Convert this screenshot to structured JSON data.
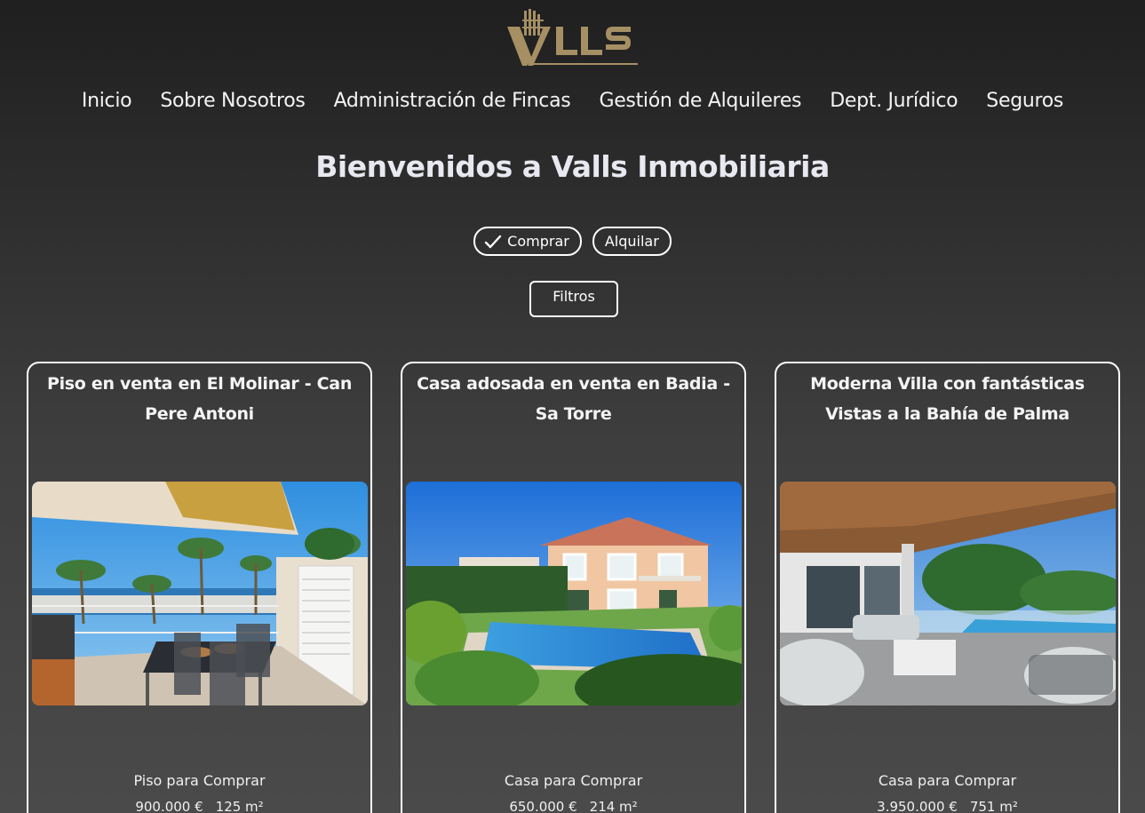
{
  "brand": {
    "logo_text": "VALLS",
    "accent": "#a58f63"
  },
  "nav": [
    {
      "label": "Inicio"
    },
    {
      "label": "Sobre Nosotros"
    },
    {
      "label": "Administración de Fincas"
    },
    {
      "label": "Gestión de Alquileres"
    },
    {
      "label": "Dept. Jurídico"
    },
    {
      "label": "Seguros"
    }
  ],
  "page_title": "Bienvenidos a Valls Inmobiliaria",
  "mode_toggle": {
    "buy_label": "Comprar",
    "buy_selected": true,
    "rent_label": "Alquilar"
  },
  "filters_label": "Filtros",
  "listings": [
    {
      "title": "Piso en venta en El Molinar - Can Pere Antoni",
      "type_label": "Piso para Comprar",
      "price": "900.000 €",
      "area": "125 m²",
      "image": "terrace-sea-view-photo"
    },
    {
      "title": "Casa adosada en venta en Badia - Sa Torre",
      "type_label": "Casa para Comprar",
      "price": "650.000 €",
      "area": "214 m²",
      "image": "house-with-pool-photo"
    },
    {
      "title": "Moderna Villa con fantásticas Vistas a la Bahía de Palma",
      "type_label": "Casa para Comprar",
      "price": "3.950.000 €",
      "area": "751 m²",
      "image": "villa-terrace-pool-photo"
    }
  ]
}
